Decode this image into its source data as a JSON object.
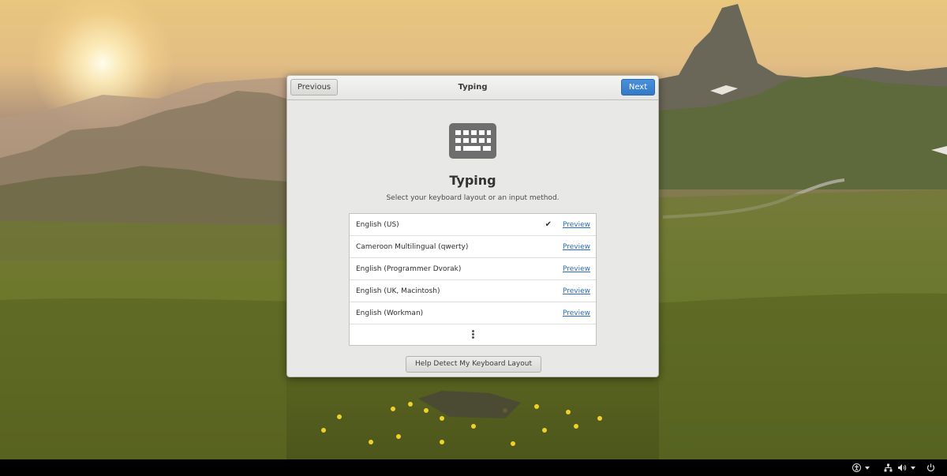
{
  "headerbar": {
    "previous_label": "Previous",
    "title": "Typing",
    "next_label": "Next"
  },
  "page": {
    "icon": "keyboard-icon",
    "title": "Typing",
    "subtitle": "Select your keyboard layout or an input method."
  },
  "layouts": [
    {
      "label": "English (US)",
      "selected": true,
      "link": "Preview"
    },
    {
      "label": "Cameroon Multilingual (qwerty)",
      "selected": false,
      "link": "Preview"
    },
    {
      "label": "English (Programmer Dvorak)",
      "selected": false,
      "link": "Preview"
    },
    {
      "label": "English (UK, Macintosh)",
      "selected": false,
      "link": "Preview"
    },
    {
      "label": "English (Workman)",
      "selected": false,
      "link": "Preview"
    }
  ],
  "more_icon": "more-vertical-icon",
  "check_glyph": "✔",
  "help_button_label": "Help Detect My Keyboard Layout",
  "system_tray": {
    "icons": [
      "accessibility-icon",
      "network-icon",
      "volume-icon",
      "power-icon"
    ]
  },
  "colors": {
    "accent": "#3b84d3",
    "link": "#2a6bc2",
    "dialog_bg": "#e8e8e7",
    "topbar": "#000000"
  }
}
